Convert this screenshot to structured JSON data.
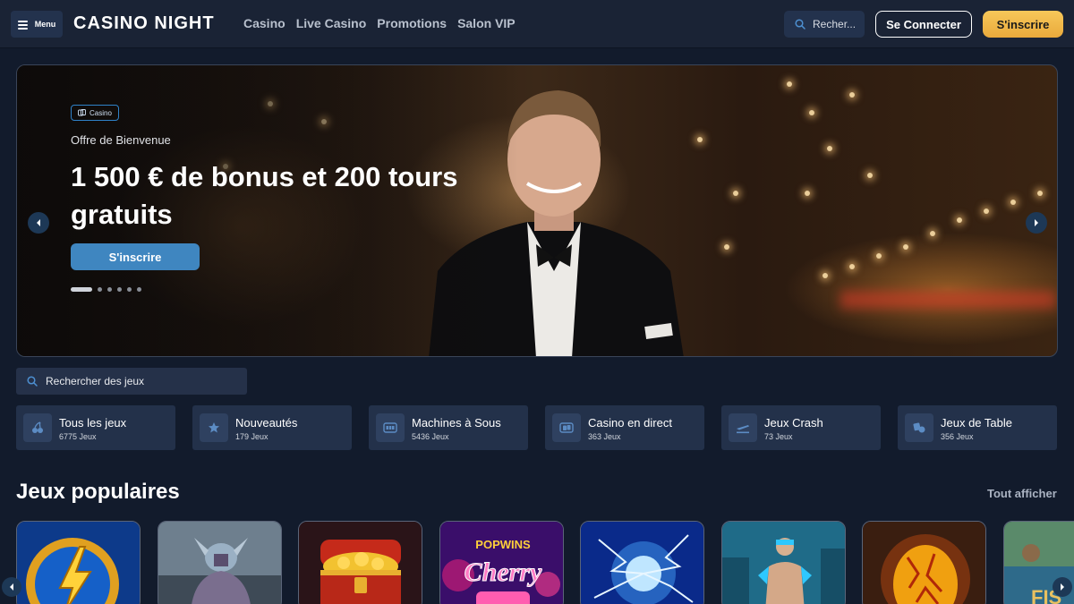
{
  "header": {
    "menu_label": "Menu",
    "logo_text": "CASINO NIGHT",
    "nav": [
      "Casino",
      "Live Casino",
      "Promotions",
      "Salon VIP"
    ],
    "search_placeholder": "Recher...",
    "login_label": "Se Connecter",
    "signup_label": "S'inscrire"
  },
  "hero": {
    "badge": "Casino",
    "eyebrow": "Offre de Bienvenue",
    "headline": "1 500 € de bonus et 200 tours gratuits",
    "cta": "S'inscrire",
    "slides_total": 6,
    "active_slide": 1
  },
  "games_search": {
    "placeholder": "Rechercher des jeux"
  },
  "categories": [
    {
      "name": "Tous les jeux",
      "count": "6775 Jeux",
      "icon": "cherries-icon"
    },
    {
      "name": "Nouveautés",
      "count": "179 Jeux",
      "icon": "star-icon"
    },
    {
      "name": "Machines à Sous",
      "count": "5436 Jeux",
      "icon": "slot-machine-icon"
    },
    {
      "name": "Casino en direct",
      "count": "363 Jeux",
      "icon": "live-cards-icon"
    },
    {
      "name": "Jeux Crash",
      "count": "73 Jeux",
      "icon": "plane-icon"
    },
    {
      "name": "Jeux de Table",
      "count": "356 Jeux",
      "icon": "chips-icon"
    }
  ],
  "popular": {
    "title": "Jeux populaires",
    "show_all": "Tout afficher",
    "tiles": [
      {
        "name": "lightning-coin-game",
        "art_text": ""
      },
      {
        "name": "viking-warrior-game",
        "art_text": ""
      },
      {
        "name": "treasure-chest-game",
        "art_text": ""
      },
      {
        "name": "cherry-pop-game",
        "art_text": "Cherry",
        "art_brand": "POPWINS"
      },
      {
        "name": "electric-orb-game",
        "art_text": ""
      },
      {
        "name": "cyber-fighter-game",
        "art_text": ""
      },
      {
        "name": "fire-egg-game",
        "art_text": ""
      },
      {
        "name": "fishing-game",
        "art_text": "FIS"
      }
    ]
  },
  "colors": {
    "background": "#121b2c",
    "header": "#1a2335",
    "accent_gold": "#f0b84a",
    "accent_blue": "#3f86c0",
    "card": "#23314a"
  }
}
